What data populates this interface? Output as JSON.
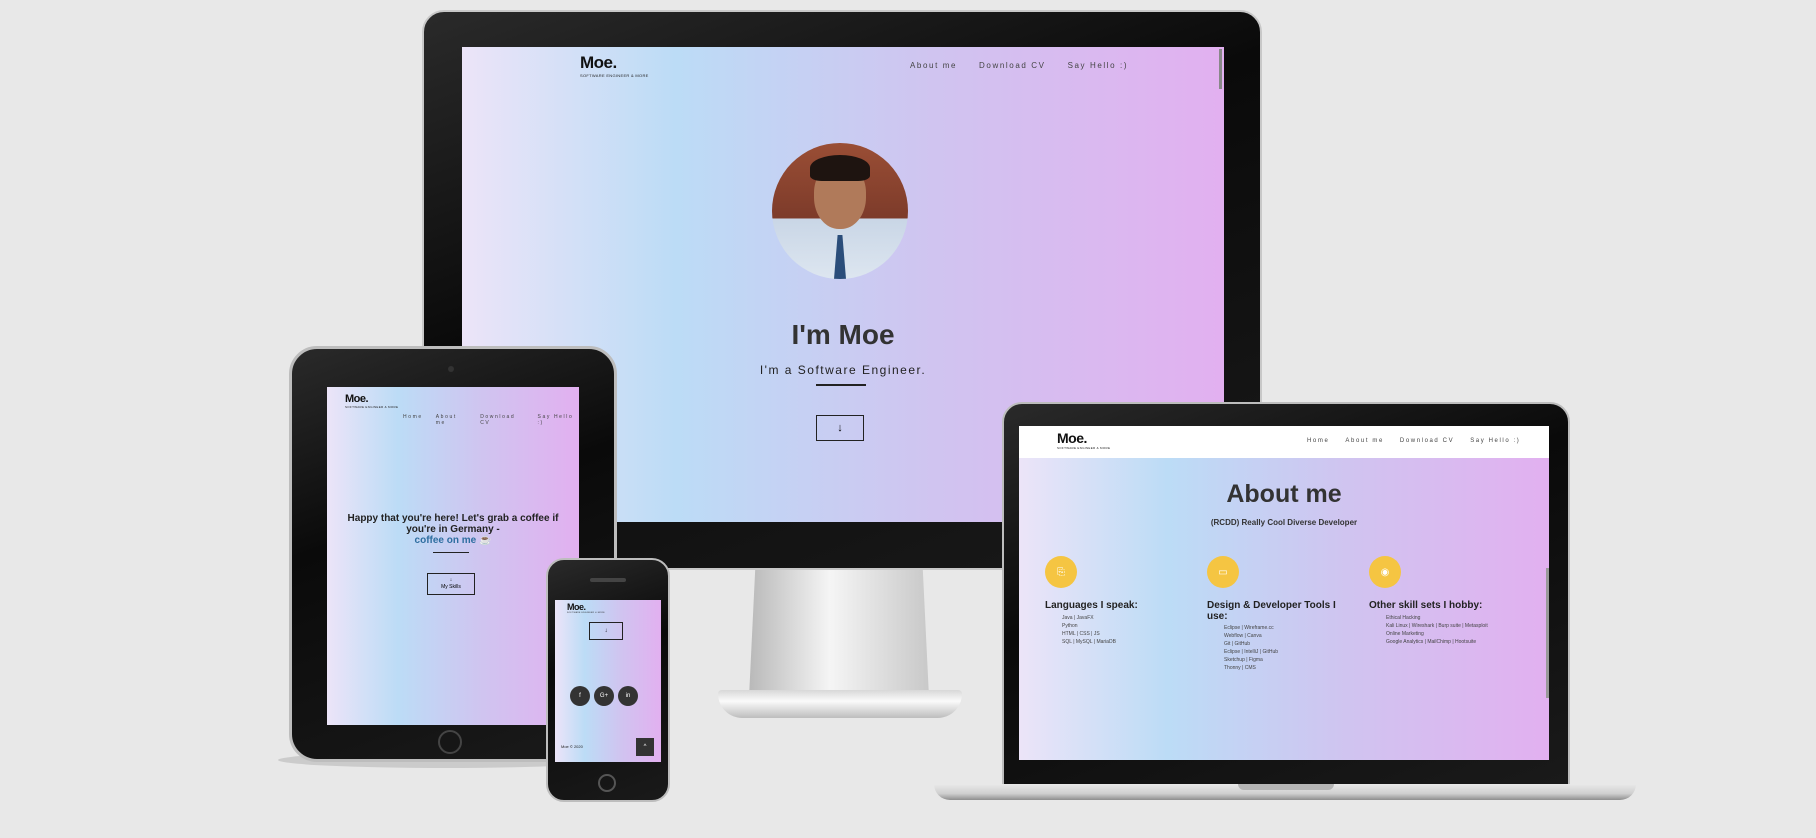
{
  "brand": {
    "logo": "Moe.",
    "tagline": "SOFTWARE ENGINEER & MORE"
  },
  "desktop": {
    "nav": [
      "About me",
      "Download CV",
      "Say Hello :)"
    ],
    "heading": "I'm Moe",
    "subheading": "I'm a Software Engineer.",
    "scroll_glyph": "↓"
  },
  "tablet": {
    "nav": [
      "Home",
      "About me",
      "Download CV",
      "Say Hello :)"
    ],
    "message_line1": "Happy that you're here! Let's grab a coffee if",
    "message_line2": "you're in Germany -",
    "coffee_link": "coffee on me ☕",
    "button_label": "My Skills",
    "button_glyph": "↓"
  },
  "laptop": {
    "nav": [
      "Home",
      "About me",
      "Download CV",
      "Say Hello :)"
    ],
    "heading": "About me",
    "subheading": "(RCDD) Really Cool Diverse Developer",
    "columns": [
      {
        "icon": "translate-icon",
        "title": "Languages I speak:",
        "lines": [
          "Java | JavaFX",
          "Python",
          "HTML | CSS | JS",
          "SQL | MySQL | MariaDB"
        ]
      },
      {
        "icon": "laptop-icon",
        "title": "Design & Developer Tools I use:",
        "lines": [
          "Eclipse | Wireframe.cc",
          "Webflow | Canva",
          "Git | GitHub",
          "Eclipse | IntelliJ | GitHub",
          "Sketchup | Figma",
          "Thonny | CMS"
        ]
      },
      {
        "icon": "globe-icon",
        "title": "Other skill sets I hobby:",
        "lines": [
          "Ethical Hacking",
          "Kali Linux | Wireshark | Burp suite | Metasploit",
          "Online Marketing",
          "Google Analytics | MailChimp | Hootsuite"
        ]
      }
    ]
  },
  "phone": {
    "button_glyph": "↓",
    "socials": [
      "f",
      "G+",
      "in"
    ],
    "footer_text": "Moe © 2020",
    "top_glyph": "^"
  },
  "colors": {
    "accent": "#f5c542",
    "link": "#2e6ea0",
    "text": "#333333"
  }
}
